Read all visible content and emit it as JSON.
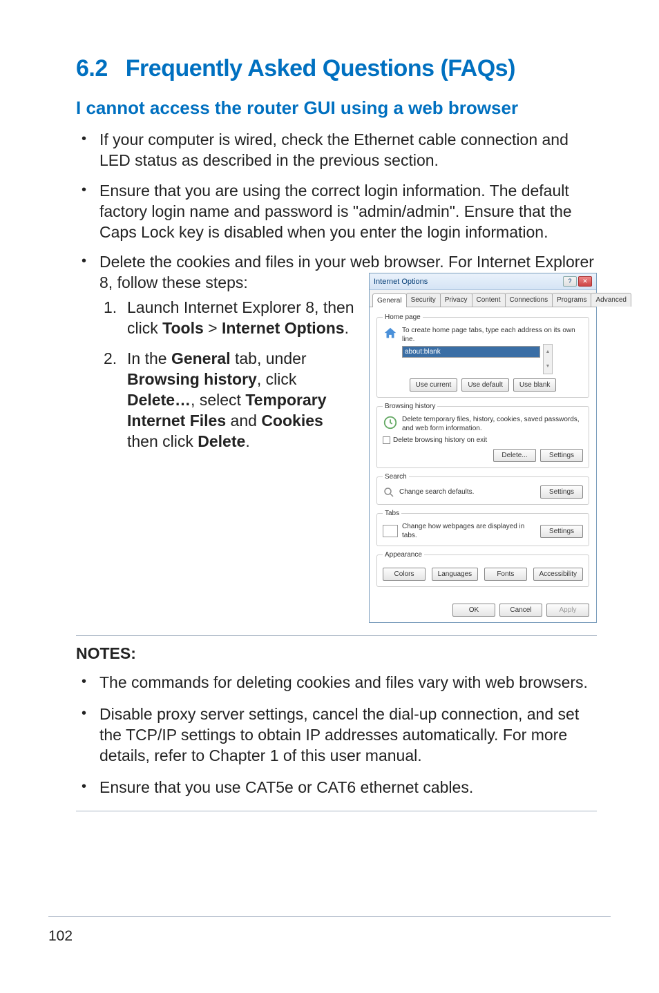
{
  "heading": {
    "number": "6.2",
    "title": "Frequently Asked Questions (FAQs)"
  },
  "subheading": "I cannot access the router GUI using a web browser",
  "bullets": {
    "b1": "If your computer is wired, check the Ethernet cable connection and LED status as described in the previous section.",
    "b2": "Ensure that you are using the correct login information. The default factory login name and password is \"admin/admin\". Ensure that the Caps Lock key is disabled when you enter the login information.",
    "b3": "Delete the cookies and files in your web browser. For Internet Explorer 8, follow these steps:"
  },
  "steps": {
    "s1_num": "1.",
    "s1_a": "Launch Internet Explorer 8, then click ",
    "s1_b": "Tools",
    "s1_c": " > ",
    "s1_d": "Internet Options",
    "s1_e": ".",
    "s2_num": "2.",
    "s2_a": "In the ",
    "s2_b": "General",
    "s2_c": " tab, under ",
    "s2_d": "Browsing history",
    "s2_e": ", click ",
    "s2_f": "Delete…",
    "s2_g": ", select ",
    "s2_h": "Temporary Internet Files",
    "s2_i": " and ",
    "s2_j": "Cookies",
    "s2_k": " then click ",
    "s2_l": "Delete",
    "s2_m": "."
  },
  "dialog": {
    "title": "Internet Options",
    "tabs": [
      "General",
      "Security",
      "Privacy",
      "Content",
      "Connections",
      "Programs",
      "Advanced"
    ],
    "homepage": {
      "legend": "Home page",
      "text": "To create home page tabs, type each address on its own line.",
      "url": "about:blank",
      "useCurrent": "Use current",
      "useDefault": "Use default",
      "useBlank": "Use blank"
    },
    "history": {
      "legend": "Browsing history",
      "text": "Delete temporary files, history, cookies, saved passwords, and web form information.",
      "checkbox": "Delete browsing history on exit",
      "delete": "Delete...",
      "settings": "Settings"
    },
    "search": {
      "legend": "Search",
      "text": "Change search defaults.",
      "settings": "Settings"
    },
    "tabsSection": {
      "legend": "Tabs",
      "text": "Change how webpages are displayed in tabs.",
      "settings": "Settings"
    },
    "appearance": {
      "legend": "Appearance",
      "colors": "Colors",
      "languages": "Languages",
      "fonts": "Fonts",
      "accessibility": "Accessibility"
    },
    "footer": {
      "ok": "OK",
      "cancel": "Cancel",
      "apply": "Apply"
    }
  },
  "notes": {
    "title": "NOTES:",
    "n1": "The commands for deleting cookies and files vary with web browsers.",
    "n2": "Disable proxy server settings, cancel the dial-up connection, and set the TCP/IP settings to obtain IP addresses automatically. For more details, refer to Chapter 1 of this user manual.",
    "n3": "Ensure that you use CAT5e or CAT6 ethernet cables."
  },
  "pageNumber": "102"
}
